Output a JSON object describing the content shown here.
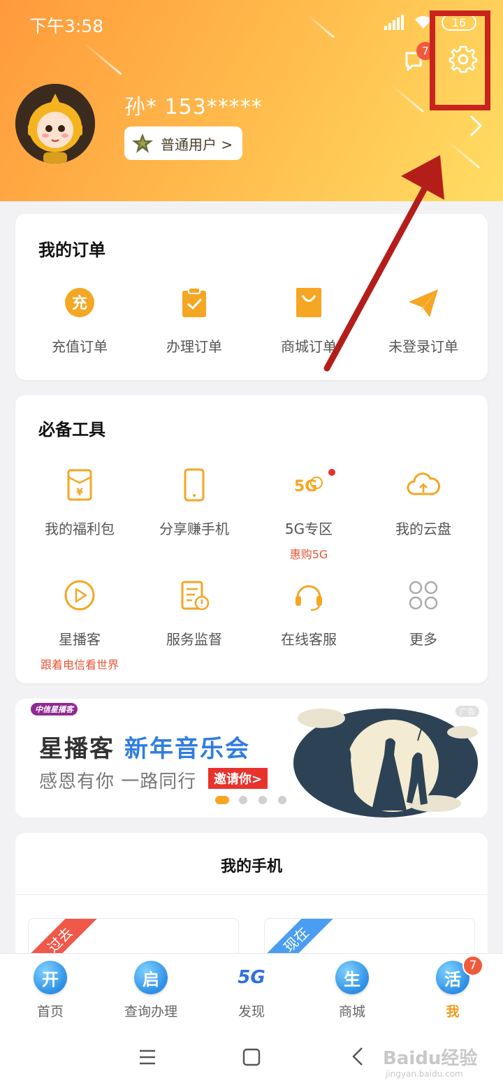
{
  "status_bar": {
    "time": "下午3:58",
    "battery": "16"
  },
  "header": {
    "message_badge": "7",
    "username": "孙* 153*****",
    "level_label": "普通用户 >"
  },
  "orders": {
    "title": "我的订单",
    "items": [
      {
        "label": "充值订单",
        "icon": "recharge-icon"
      },
      {
        "label": "办理订单",
        "icon": "clipboard-check-icon"
      },
      {
        "label": "商城订单",
        "icon": "shopping-bag-icon"
      },
      {
        "label": "未登录订单",
        "icon": "paper-plane-icon"
      }
    ]
  },
  "tools": {
    "title": "必备工具",
    "items": [
      {
        "label": "我的福利包",
        "icon": "red-envelope-icon",
        "sub": ""
      },
      {
        "label": "分享赚手机",
        "icon": "phone-icon",
        "sub": ""
      },
      {
        "label": "5G专区",
        "icon": "5g-hello-icon",
        "sub": "惠购5G"
      },
      {
        "label": "我的云盘",
        "icon": "cloud-icon",
        "sub": ""
      },
      {
        "label": "星播客",
        "icon": "play-circle-icon",
        "sub": "跟着电信看世界"
      },
      {
        "label": "服务监督",
        "icon": "document-alert-icon",
        "sub": ""
      },
      {
        "label": "在线客服",
        "icon": "headset-icon",
        "sub": ""
      },
      {
        "label": "更多",
        "icon": "more-grid-icon",
        "sub": ""
      }
    ]
  },
  "banner": {
    "logo": "中信星播客",
    "title_part1": "星播客",
    "title_part2": "新年音乐会",
    "subtitle": "感恩有你 一路同行",
    "cta": "邀请你>",
    "ad_label": "广告",
    "active_slide": 1
  },
  "my_phone": {
    "title": "我的手机",
    "past": "过去",
    "now": "现在"
  },
  "bottom_nav": {
    "items": [
      {
        "label": "首页",
        "icon_char": "开"
      },
      {
        "label": "查询办理",
        "icon_char": "启"
      },
      {
        "label": "发现",
        "icon_char": "5G"
      },
      {
        "label": "商城",
        "icon_char": "生"
      },
      {
        "label": "我",
        "icon_char": "活",
        "badge": "7"
      }
    ]
  },
  "watermark": {
    "brand": "Baidu经验",
    "url": "jingyan.baidu.com"
  },
  "colors": {
    "accent_orange": "#f5a623",
    "highlight_red": "#c8231c",
    "badge_red": "#f05a3c",
    "link_blue": "#2f7de0"
  }
}
